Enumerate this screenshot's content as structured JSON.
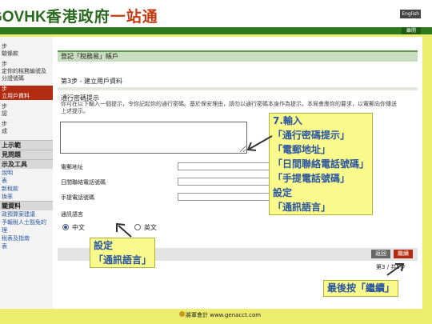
{
  "header": {
    "logo_gov": "GOV",
    "logo_hk": "HK",
    "logo_zh": "香港政府",
    "logo_zh2": "一站通",
    "lang_button": "English",
    "logout": "離開"
  },
  "sidebar": {
    "items": [
      {
        "label": "步",
        "active": false
      },
      {
        "label": "驗條款",
        "active": false
      },
      {
        "label": "步",
        "active": false
      },
      {
        "label": "定你的稅務編號及",
        "active": false
      },
      {
        "label": "分證號碼",
        "active": false
      },
      {
        "label": "步",
        "active": true
      },
      {
        "label": "立用戶資料",
        "active": true
      },
      {
        "label": "步",
        "active": false
      },
      {
        "label": "認",
        "active": false
      },
      {
        "label": "步",
        "active": false
      },
      {
        "label": "成",
        "active": false
      }
    ],
    "sections": [
      {
        "label": "上示範"
      },
      {
        "label": "見問題"
      },
      {
        "label": "示及工具"
      }
    ],
    "links": [
      "說明",
      "表",
      "新稅款",
      "換率",
      "關資料",
      "政預算案建議",
      "予報稅人士豁免的",
      "理",
      "稅表及指南",
      "表"
    ]
  },
  "main": {
    "title": "登記「稅務易」帳戶",
    "step": "第3步 - 建立用戶資料",
    "hint_label": "通行密碼提示",
    "hint_desc": "你可在以下輸入一個提示，令你記起你的通行密碼。基於保安理由，請勿以通行密碼本身作為提示。本局會應你的要求，以電郵向你傳送上述提示。",
    "rows": [
      {
        "label": "電郵地址"
      },
      {
        "label": "日間聯絡電話號碼"
      },
      {
        "label": "手提電話號碼"
      }
    ],
    "lang_label": "通訊語言",
    "lang_options": [
      {
        "label": "中文",
        "checked": true
      },
      {
        "label": "英文",
        "checked": false
      }
    ],
    "back_button": "返回",
    "next_button": "繼續",
    "pager_num": "第3",
    "pager_sep": "/",
    "pager_total": "共5步"
  },
  "annotations": {
    "note1_lines": [
      "7.輸入",
      "「通行密碼提示」",
      "「電郵地址」",
      "「日間聯絡電話號碼」",
      "「手提電話號碼」",
      "設定",
      "「通訊語言」"
    ],
    "note2_lines": [
      "設定",
      "「通訊語言」"
    ],
    "note3": "最後按「繼續」"
  },
  "footer": {
    "text": "將軍會計 www.genacct.com"
  },
  "colors": {
    "accent_green": "#2f7a1f",
    "accent_red": "#b22a10",
    "annotation_blue": "#2a55a0",
    "background_yellow": "#ecec6e"
  }
}
